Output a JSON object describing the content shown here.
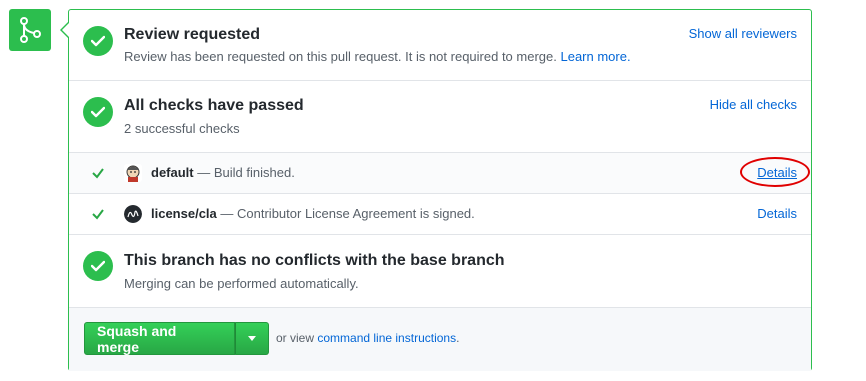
{
  "colors": {
    "success": "#2cbe4e",
    "link": "#0366d6",
    "highlight": "#e00000"
  },
  "merge_icon": "git-merge-icon",
  "review": {
    "title": "Review requested",
    "description": "Review has been requested on this pull request. It is not required to merge.",
    "learn_more": "Learn more.",
    "show_reviewers": "Show all reviewers"
  },
  "checks": {
    "title": "All checks have passed",
    "subtitle": "2 successful checks",
    "hide_checks": "Hide all checks",
    "items": [
      {
        "name": "default",
        "description": "— Build finished.",
        "details": "Details",
        "avatar": "jenkins-avatar-icon"
      },
      {
        "name": "license/cla",
        "description": "— Contributor License Agreement is signed.",
        "details": "Details",
        "avatar": "cla-avatar-icon"
      }
    ]
  },
  "conflicts": {
    "title": "This branch has no conflicts with the base branch",
    "description": "Merging can be performed automatically."
  },
  "merge": {
    "button_label": "Squash and merge",
    "or_view": "or view",
    "cli_link": "command line instructions",
    "period": "."
  }
}
